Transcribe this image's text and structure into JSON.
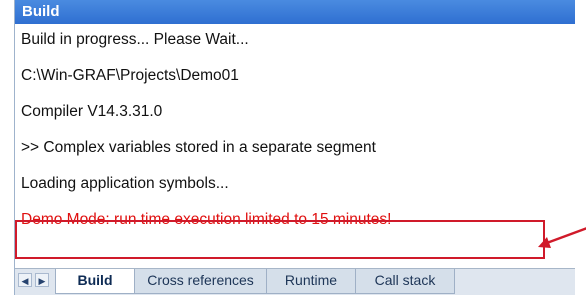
{
  "window": {
    "title": "Build"
  },
  "output_lines": [
    "Build in progress... Please Wait...",
    " C:\\Win-GRAF\\Projects\\Demo01",
    "Compiler V14.3.31.0",
    ">> Complex variables stored in a separate segment",
    "Loading application symbols...",
    "Demo Mode: run time execution limited to 15 minutes!"
  ],
  "nav": {
    "prev": "◀",
    "next": "▶"
  },
  "tabs": [
    {
      "label": "Build",
      "active": true
    },
    {
      "label": "Cross references",
      "active": false
    },
    {
      "label": "Runtime",
      "active": false
    },
    {
      "label": "Call stack",
      "active": false
    }
  ],
  "colors": {
    "title_bar": "#2f6fd1",
    "demo_text": "#e01010",
    "highlight_box": "#d01a2a"
  }
}
